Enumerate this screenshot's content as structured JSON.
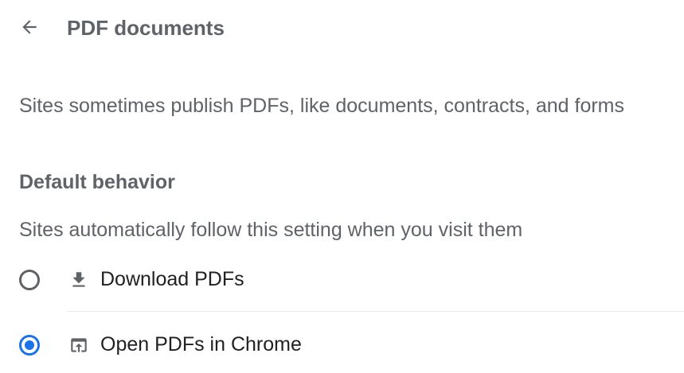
{
  "header": {
    "back_icon": "arrow-back-icon",
    "title": "PDF documents"
  },
  "description": "Sites sometimes publish PDFs, like documents, contracts, and forms",
  "default_behavior": {
    "heading": "Default behavior",
    "subtitle": "Sites automatically follow this setting when you visit them",
    "options": [
      {
        "label": "Download PDFs",
        "icon": "download-icon",
        "selected": false
      },
      {
        "label": "Open PDFs in Chrome",
        "icon": "open-in-browser-icon",
        "selected": true
      }
    ]
  },
  "colors": {
    "accent": "#1a73e8",
    "secondary_text": "#5f6368",
    "primary_text": "#202124",
    "divider": "#e8eaed"
  }
}
